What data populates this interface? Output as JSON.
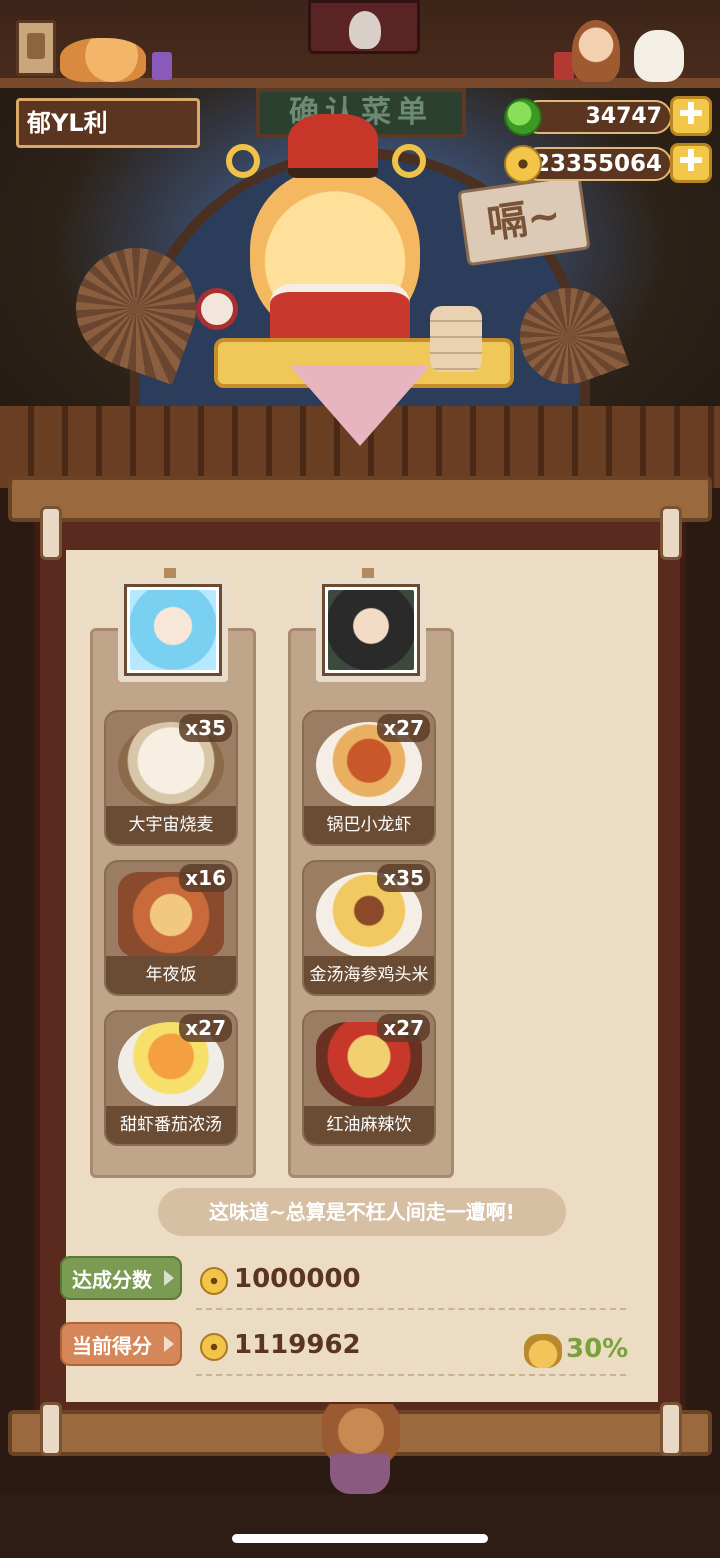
{
  "player": {
    "name": "郁YL利"
  },
  "currency": {
    "jade": "34747",
    "gold": "23355064",
    "plus_symbol": "✚"
  },
  "scene": {
    "sign_text": "确认菜单",
    "speech_text": "嗝~"
  },
  "columns": [
    {
      "dishes": [
        {
          "name": "大宇宙烧麦",
          "count": "x35"
        },
        {
          "name": "年夜饭",
          "count": "x16"
        },
        {
          "name": "甜虾番茄浓汤",
          "count": "x27"
        }
      ]
    },
    {
      "dishes": [
        {
          "name": "锅巴小龙虾",
          "count": "x27"
        },
        {
          "name": "金汤海参鸡头米",
          "count": "x35"
        },
        {
          "name": "红油麻辣饮",
          "count": "x27"
        }
      ]
    }
  ],
  "message": "这味道~总算是不枉人间走一遭啊!",
  "scores": {
    "target_label": "达成分数",
    "target_value": "1000000",
    "current_label": "当前得分",
    "current_value": "1119962",
    "bonus": "30%"
  },
  "colors": {
    "target_tag": "#7b9a52",
    "current_tag": "#d6875a",
    "bonus_text": "#7aa23c",
    "paper": "#ecdcc3"
  }
}
